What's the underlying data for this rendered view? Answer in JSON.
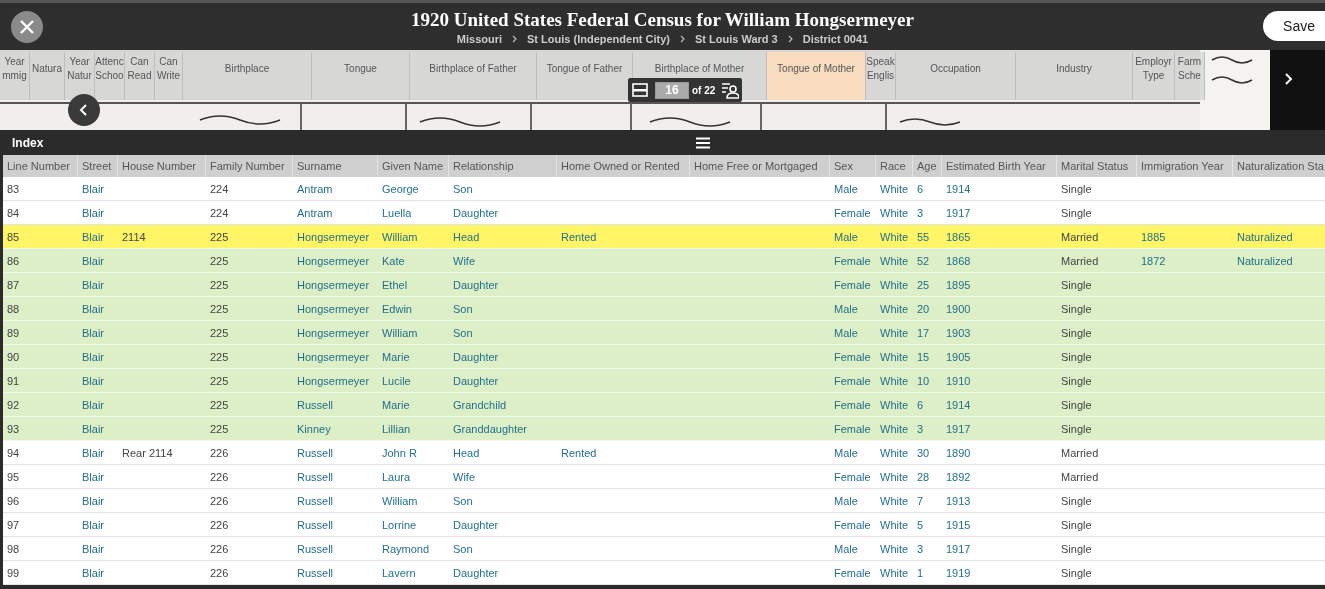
{
  "header": {
    "title": "1920 United States Federal Census for William Hongsermeyer",
    "breadcrumbs": [
      "Missouri",
      "St Louis (Independent City)",
      "St Louis Ward 3",
      "District 0041"
    ],
    "save_label": "Save"
  },
  "image_strip": {
    "columns": [
      {
        "label": "Year mmig",
        "highlighted": false
      },
      {
        "label": "Natura",
        "highlighted": false
      },
      {
        "label": "Year Natur",
        "highlighted": false
      },
      {
        "label": "Attenc Schoo",
        "highlighted": false
      },
      {
        "label": "Can Read",
        "highlighted": false
      },
      {
        "label": "Can Write",
        "highlighted": false
      },
      {
        "label": "Birthplace",
        "highlighted": false
      },
      {
        "label": "Tongue",
        "highlighted": false
      },
      {
        "label": "Birthplace of Father",
        "highlighted": false
      },
      {
        "label": "Tongue of Father",
        "highlighted": false
      },
      {
        "label": "Birthplace of Mother",
        "highlighted": false
      },
      {
        "label": "Tongue of Mother",
        "highlighted": true
      },
      {
        "label": "Speak Englis",
        "highlighted": false
      },
      {
        "label": "Occupation",
        "highlighted": false
      },
      {
        "label": "Industry",
        "highlighted": false
      },
      {
        "label": "Employr Type",
        "highlighted": false
      },
      {
        "label": "Farm Sche",
        "highlighted": false
      }
    ],
    "page": "16",
    "page_total": "of 22"
  },
  "index": {
    "title": "Index",
    "columns": [
      "Line Number",
      "Street",
      "House Number",
      "Family Number",
      "Surname",
      "Given Name",
      "Relationship",
      "Home Owned or Rented",
      "Home Free or Mortgaged",
      "Sex",
      "Race",
      "Age",
      "Estimated Birth Year",
      "Marital Status",
      "Immigration Year",
      "Naturalization Sta"
    ],
    "rows": [
      {
        "selected": false,
        "household": false,
        "cells": [
          "83",
          "Blair",
          null,
          "224",
          "Antram",
          "George",
          "Son",
          null,
          null,
          "Male",
          "White",
          "6",
          "1914",
          "Single",
          null,
          null
        ]
      },
      {
        "selected": false,
        "household": false,
        "cells": [
          "84",
          "Blair",
          null,
          "224",
          "Antram",
          "Luella",
          "Daughter",
          null,
          null,
          "Female",
          "White",
          "3",
          "1917",
          "Single",
          null,
          null
        ]
      },
      {
        "selected": true,
        "household": true,
        "cells": [
          "85",
          "Blair",
          "2114",
          "225",
          "Hongsermeyer",
          "William",
          "Head",
          "Rented",
          null,
          "Male",
          "White",
          "55",
          "1865",
          "Married",
          "1885",
          "Naturalized"
        ]
      },
      {
        "selected": false,
        "household": true,
        "cells": [
          "86",
          "Blair",
          null,
          "225",
          "Hongsermeyer",
          "Kate",
          "Wife",
          null,
          null,
          "Female",
          "White",
          "52",
          "1868",
          "Married",
          "1872",
          "Naturalized"
        ]
      },
      {
        "selected": false,
        "household": true,
        "cells": [
          "87",
          "Blair",
          null,
          "225",
          "Hongsermeyer",
          "Ethel",
          "Daughter",
          null,
          null,
          "Female",
          "White",
          "25",
          "1895",
          "Single",
          null,
          null
        ]
      },
      {
        "selected": false,
        "household": true,
        "cells": [
          "88",
          "Blair",
          null,
          "225",
          "Hongsermeyer",
          "Edwin",
          "Son",
          null,
          null,
          "Male",
          "White",
          "20",
          "1900",
          "Single",
          null,
          null
        ]
      },
      {
        "selected": false,
        "household": true,
        "cells": [
          "89",
          "Blair",
          null,
          "225",
          "Hongsermeyer",
          "William",
          "Son",
          null,
          null,
          "Male",
          "White",
          "17",
          "1903",
          "Single",
          null,
          null
        ]
      },
      {
        "selected": false,
        "household": true,
        "cells": [
          "90",
          "Blair",
          null,
          "225",
          "Hongsermeyer",
          "Marie",
          "Daughter",
          null,
          null,
          "Female",
          "White",
          "15",
          "1905",
          "Single",
          null,
          null
        ]
      },
      {
        "selected": false,
        "household": true,
        "cells": [
          "91",
          "Blair",
          null,
          "225",
          "Hongsermeyer",
          "Lucile",
          "Daughter",
          null,
          null,
          "Female",
          "White",
          "10",
          "1910",
          "Single",
          null,
          null
        ]
      },
      {
        "selected": false,
        "household": true,
        "cells": [
          "92",
          "Blair",
          null,
          "225",
          "Russell",
          "Marie",
          "Grandchild",
          null,
          null,
          "Female",
          "White",
          "6",
          "1914",
          "Single",
          null,
          null
        ]
      },
      {
        "selected": false,
        "household": true,
        "cells": [
          "93",
          "Blair",
          null,
          "225",
          "Kinney",
          "Lillian",
          "Granddaughter",
          null,
          null,
          "Female",
          "White",
          "3",
          "1917",
          "Single",
          null,
          null
        ]
      },
      {
        "selected": false,
        "household": false,
        "cells": [
          "94",
          "Blair",
          "Rear 2114",
          "226",
          "Russell",
          "John R",
          "Head",
          "Rented",
          null,
          "Male",
          "White",
          "30",
          "1890",
          "Married",
          null,
          null
        ]
      },
      {
        "selected": false,
        "household": false,
        "cells": [
          "95",
          "Blair",
          null,
          "226",
          "Russell",
          "Laura",
          "Wife",
          null,
          null,
          "Female",
          "White",
          "28",
          "1892",
          "Married",
          null,
          null
        ]
      },
      {
        "selected": false,
        "household": false,
        "cells": [
          "96",
          "Blair",
          null,
          "226",
          "Russell",
          "William",
          "Son",
          null,
          null,
          "Male",
          "White",
          "7",
          "1913",
          "Single",
          null,
          null
        ]
      },
      {
        "selected": false,
        "household": false,
        "cells": [
          "97",
          "Blair",
          null,
          "226",
          "Russell",
          "Lorrine",
          "Daughter",
          null,
          null,
          "Female",
          "White",
          "5",
          "1915",
          "Single",
          null,
          null
        ]
      },
      {
        "selected": false,
        "household": false,
        "cells": [
          "98",
          "Blair",
          null,
          "226",
          "Russell",
          "Raymond",
          "Son",
          null,
          null,
          "Male",
          "White",
          "3",
          "1917",
          "Single",
          null,
          null
        ]
      },
      {
        "selected": false,
        "household": false,
        "cells": [
          "99",
          "Blair",
          null,
          "226",
          "Russell",
          "Lavern",
          "Daughter",
          null,
          null,
          "Female",
          "White",
          "1",
          "1919",
          "Single",
          null,
          null
        ]
      }
    ]
  }
}
